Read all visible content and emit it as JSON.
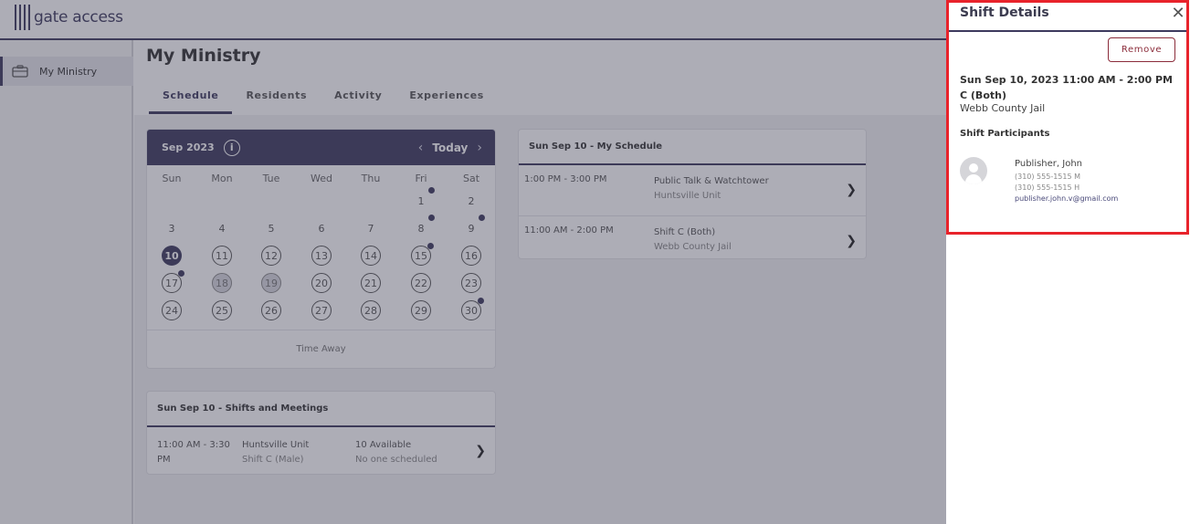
{
  "app": {
    "logo_text": "gate access"
  },
  "sidebar": {
    "items": [
      {
        "label": "My Ministry",
        "icon": "briefcase-icon"
      }
    ]
  },
  "main": {
    "title": "My Ministry",
    "tabs": [
      {
        "label": "Schedule",
        "active": true
      },
      {
        "label": "Residents"
      },
      {
        "label": "Activity"
      },
      {
        "label": "Experiences"
      }
    ]
  },
  "calendar": {
    "month_label": "Sep 2023",
    "today_label": "Today",
    "weekdays": [
      "Sun",
      "Mon",
      "Tue",
      "Wed",
      "Thu",
      "Fri",
      "Sat"
    ],
    "days": [
      {
        "n": "1",
        "dot": true
      },
      {
        "n": "2"
      },
      {
        "n": "3"
      },
      {
        "n": "4"
      },
      {
        "n": "5"
      },
      {
        "n": "6"
      },
      {
        "n": "7"
      },
      {
        "n": "8",
        "dot": true
      },
      {
        "n": "9",
        "dot": true
      },
      {
        "n": "10",
        "selected": true
      },
      {
        "n": "11",
        "circle": true
      },
      {
        "n": "12",
        "circle": true
      },
      {
        "n": "13",
        "circle": true
      },
      {
        "n": "14",
        "circle": true
      },
      {
        "n": "15",
        "circle": true,
        "dot": true
      },
      {
        "n": "16",
        "circle": true
      },
      {
        "n": "17",
        "circle": true,
        "dot": true
      },
      {
        "n": "18",
        "muted": true
      },
      {
        "n": "19",
        "muted": true
      },
      {
        "n": "20",
        "circle": true
      },
      {
        "n": "21",
        "circle": true
      },
      {
        "n": "22",
        "circle": true
      },
      {
        "n": "23",
        "circle": true
      },
      {
        "n": "24",
        "circle": true
      },
      {
        "n": "25",
        "circle": true
      },
      {
        "n": "26",
        "circle": true
      },
      {
        "n": "27",
        "circle": true
      },
      {
        "n": "28",
        "circle": true
      },
      {
        "n": "29",
        "circle": true
      },
      {
        "n": "30",
        "circle": true,
        "dot": true
      }
    ],
    "footer_label": "Time Away"
  },
  "schedule": {
    "title": "Sun Sep 10 - My Schedule",
    "rows": [
      {
        "time": "1:00 PM - 3:00 PM",
        "name": "Public Talk & Watchtower",
        "location": "Huntsville Unit"
      },
      {
        "time": "11:00 AM - 2:00 PM",
        "name": "Shift C (Both)",
        "location": "Webb County Jail"
      }
    ]
  },
  "shifts": {
    "title": "Sun Sep 10 - Shifts and Meetings",
    "rows": [
      {
        "time_line1": "11:00 AM - 3:30",
        "time_line2": "PM",
        "location": "Huntsville Unit",
        "name": "Shift C (Male)",
        "availability": "10 Available",
        "scheduled": "No one scheduled"
      }
    ]
  },
  "details": {
    "title": "Shift Details",
    "remove_label": "Remove",
    "when_line1": "Sun Sep 10, 2023 11:00 AM - 2:00 PM",
    "when_line2": "C (Both)",
    "where": "Webb County Jail",
    "participants_title": "Shift Participants",
    "participants": [
      {
        "name": "Publisher, John",
        "phone_mobile": "(310) 555-1515 M",
        "phone_home": "(310) 555-1515 H",
        "email": "publisher.john.v@gmail.com"
      }
    ]
  },
  "colors": {
    "primary": "#3d3a5e",
    "highlight": "#e8232b",
    "remove": "#8b2c3a"
  }
}
